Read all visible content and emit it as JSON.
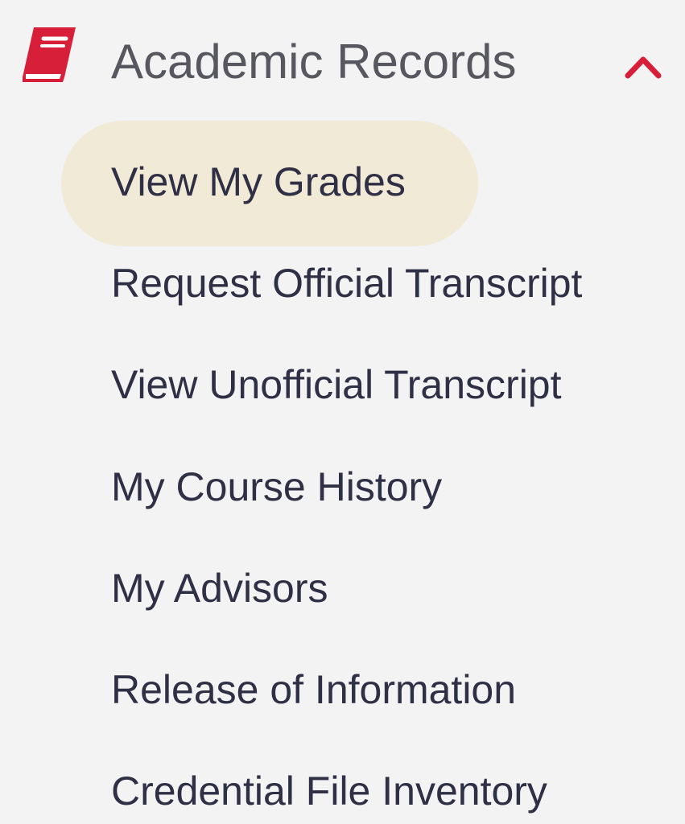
{
  "section": {
    "title": "Academic Records",
    "icon": "book-icon",
    "expand_icon": "chevron-up-icon",
    "expanded": true
  },
  "colors": {
    "accent": "#d81f3a",
    "active_background": "#f1ead6",
    "background": "#f3f3f3"
  },
  "items": [
    {
      "label": "View My Grades",
      "active": true
    },
    {
      "label": "Request Official Transcript",
      "active": false
    },
    {
      "label": "View Unofficial Transcript",
      "active": false
    },
    {
      "label": "My Course History",
      "active": false
    },
    {
      "label": "My Advisors",
      "active": false
    },
    {
      "label": "Release of Information",
      "active": false
    },
    {
      "label": "Credential File Inventory",
      "active": false
    }
  ]
}
